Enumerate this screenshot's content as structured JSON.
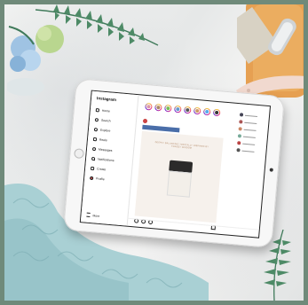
{
  "scene": {
    "description_colors": {
      "frame": "#6f8a7a",
      "knit": "#a9d0d4",
      "board": "#e39a4a",
      "strap": "#f1d9cf"
    }
  },
  "app": {
    "logo": "Instagram",
    "nav": [
      {
        "label": "Home",
        "icon": "home-icon"
      },
      {
        "label": "Search",
        "icon": "search-icon"
      },
      {
        "label": "Explore",
        "icon": "compass-icon"
      },
      {
        "label": "Reels",
        "icon": "reels-icon"
      },
      {
        "label": "Messages",
        "icon": "message-icon"
      },
      {
        "label": "Notifications",
        "icon": "heart-icon"
      },
      {
        "label": "Create",
        "icon": "plus-icon"
      },
      {
        "label": "Profile",
        "icon": "profile-icon"
      }
    ],
    "more_label": "More",
    "stories": [
      "",
      "",
      "",
      "",
      "",
      "",
      "",
      ""
    ],
    "post": {
      "username": "",
      "sponsored": "",
      "cta": "",
      "title": "DEEPLY BALANCING TOPICALLY INSPIRED BY FOREST WISDOM",
      "jar_brand": "",
      "jar_product": ""
    }
  }
}
